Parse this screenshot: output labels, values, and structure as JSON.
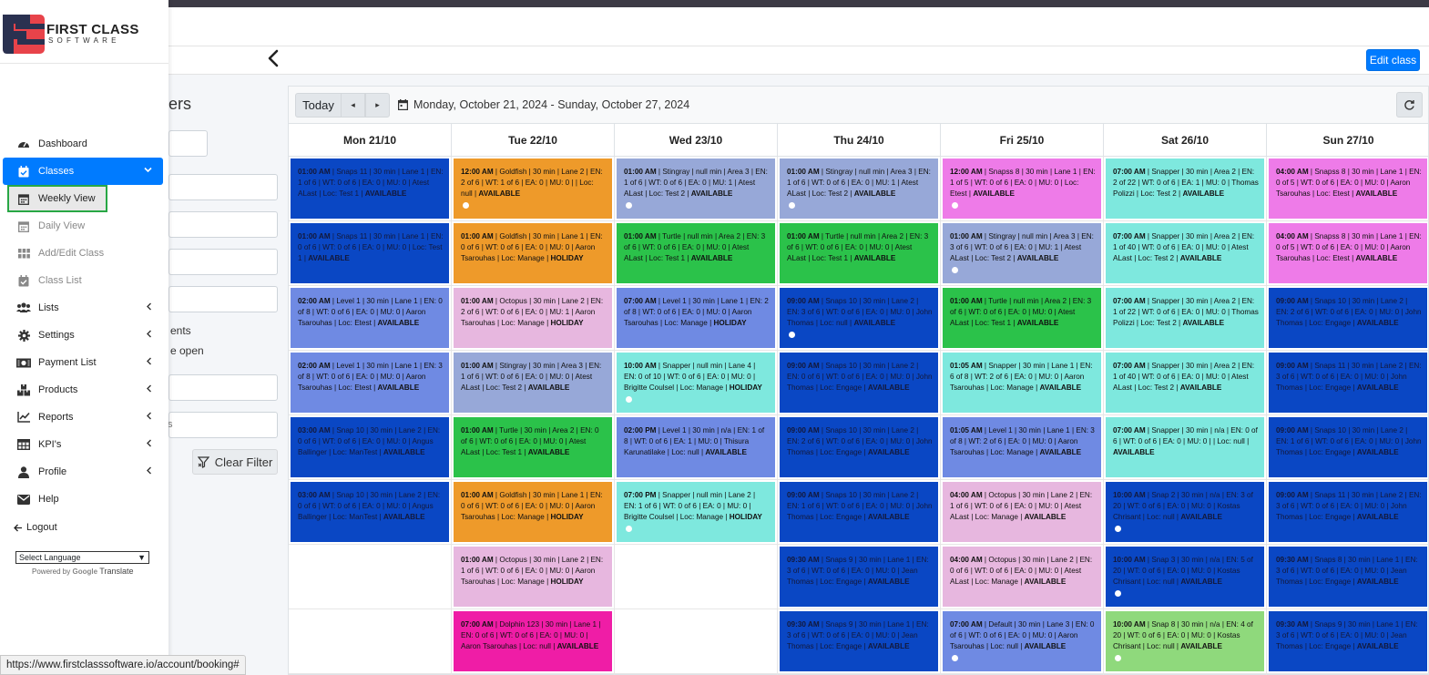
{
  "brand": {
    "line1": "FIRST CLASS",
    "line2": "SOFTWARE",
    "colors": {
      "red": "#e8434a",
      "navy": "#2a3150"
    }
  },
  "header": {
    "edit_class_label": "Edit class"
  },
  "filters": {
    "title_fragment": "ers",
    "check1_fragment": "ents",
    "check2_fragment": "e open",
    "ghost_fragment": "s",
    "clear_label": "Clear Filter"
  },
  "calendar": {
    "today_label": "Today",
    "prev_label": "◂",
    "next_label": "▸",
    "date_range": "Monday, October 21, 2024 - Sunday, October 27, 2024",
    "days": [
      "Mon 21/10",
      "Tue 22/10",
      "Wed 23/10",
      "Thu 24/10",
      "Fri 25/10",
      "Sat 26/10",
      "Sun 27/10"
    ],
    "columns": [
      [
        {
          "time": "01:00 AM",
          "text": " | Snaps 11 | 30 min | Lane 1 | EN: 1 of 6 | WT: 0 of 6 | EA: 0 | MU: 0 | Atest ALast | Loc: Test 1 | ",
          "status": "AVAILABLE",
          "color": "#0a47c4",
          "dark": true,
          "dot": false
        },
        {
          "time": "01:00 AM",
          "text": " | Snaps 11 | 30 min | Lane 1 | EN: 0 of 6 | WT: 0 of 6 | EA: 0 | MU: 0 | Loc: Test 1 | ",
          "status": "AVAILABLE",
          "color": "#0a47c4",
          "dark": true,
          "dot": false
        },
        {
          "time": "02:00 AM",
          "text": " | Level 1 | 30 min | Lane 1 | EN: 0 of 8 | WT: 0 of 6 | EA: 0 | MU: 0 | Aaron Tsarouhas | Loc: Etest | ",
          "status": "AVAILABLE",
          "color": "#6f8ae3",
          "dark": false,
          "dot": false
        },
        {
          "time": "02:00 AM",
          "text": " | Level 1 | 30 min | Lane 1 | EN: 3 of 8 | WT: 0 of 6 | EA: 0 | MU: 0 | Aaron Tsarouhas | Loc: Etest | ",
          "status": "AVAILABLE",
          "color": "#6f8ae3",
          "dark": false,
          "dot": false
        },
        {
          "time": "03:00 AM",
          "text": " | Snap 10 | 30 min | Lane 2 | EN: 0 of 6 | WT: 0 of 6 | EA: 0 | MU: 0 | Angus Ballinger | Loc: ManTest | ",
          "status": "AVAILABLE",
          "color": "#0a47c4",
          "dark": true,
          "dot": false
        },
        {
          "time": "03:00 AM",
          "text": " | Snap 10 | 30 min | Lane 2 | EN: 0 of 6 | WT: 0 of 6 | EA: 0 | MU: 0 | Angus Ballinger | Loc: ManTest | ",
          "status": "AVAILABLE",
          "color": "#0a47c4",
          "dark": true,
          "dot": false
        },
        null,
        null
      ],
      [
        {
          "time": "12:00 AM",
          "text": " | Goldfish | 30 min | Lane 2 | EN: 2 of 6 | WT: 1 of 6 | EA: 0 | MU: 0 | | Loc: null | ",
          "status": "AVAILABLE",
          "color": "#ee9a2a",
          "dark": false,
          "dot": true
        },
        {
          "time": "01:00 AM",
          "text": " | Goldfish | 30 min | Lane 1 | EN: 0 of 6 | WT: 0 of 6 | EA: 0 | MU: 0 | Aaron Tsarouhas | Loc: Manage | ",
          "status": "HOLIDAY",
          "color": "#ee9a2a",
          "dark": false,
          "dot": false
        },
        {
          "time": "01:00 AM",
          "text": " | Octopus | 30 min | Lane 2 | EN: 2 of 6 | WT: 0 of 6 | EA: 0 | MU: 1 | Aaron Tsarouhas | Loc: Manage | ",
          "status": "HOLIDAY",
          "color": "#e7b7df",
          "dark": false,
          "dot": false
        },
        {
          "time": "01:00 AM",
          "text": " | Stingray | 30 min | Area 3 | EN: 1 of 6 | WT: 0 of 6 | EA: 0 | MU: 0 | Atest ALast | Loc: Test 2 | ",
          "status": "AVAILABLE",
          "color": "#97a8d8",
          "dark": false,
          "dot": false
        },
        {
          "time": "01:00 AM",
          "text": " | Turtle | 30 min | Area 2 | EN: 0 of 6 | WT: 0 of 6 | EA: 0 | MU: 0 | Atest ALast | Loc: Test 1 | ",
          "status": "AVAILABLE",
          "color": "#2bc24a",
          "dark": false,
          "dot": false
        },
        {
          "time": "01:00 AM",
          "text": " | Goldfish | 30 min | Lane 1 | EN: 0 of 6 | WT: 0 of 6 | EA: 0 | MU: 0 | Aaron Tsarouhas | Loc: Manage | ",
          "status": "HOLIDAY",
          "color": "#ee9a2a",
          "dark": false,
          "dot": false
        },
        {
          "time": "01:00 AM",
          "text": " | Octopus | 30 min | Lane 2 | EN: 1 of 6 | WT: 0 of 6 | EA: 0 | MU: 0 | Aaron Tsarouhas | Loc: Manage | ",
          "status": "HOLIDAY",
          "color": "#e7b7df",
          "dark": false,
          "dot": false
        },
        {
          "time": "07:00 AM",
          "text": " | Dolphin 123 | 30 min | Lane 1 | EN: 0 of 6 | WT: 0 of 6 | EA: 0 | MU: 0 | Aaron Tsarouhas | Loc: null | ",
          "status": "AVAILABLE",
          "color": "#ef1da6",
          "dark": false,
          "dot": false
        }
      ],
      [
        {
          "time": "01:00 AM",
          "text": " | Stingray | null min | Area 3 | EN: 1 of 6 | WT: 0 of 6 | EA: 0 | MU: 1 | Atest ALast | Loc: Test 2 | ",
          "status": "AVAILABLE",
          "color": "#97a8d8",
          "dark": false,
          "dot": true
        },
        {
          "time": "01:00 AM",
          "text": " | Turtle | null min | Area 2 | EN: 3 of 6 | WT: 0 of 6 | EA: 0 | MU: 0 | Atest ALast | Loc: Test 1 | ",
          "status": "AVAILABLE",
          "color": "#2bc24a",
          "dark": false,
          "dot": false
        },
        {
          "time": "07:00 AM",
          "text": " | Level 1 | 30 min | Lane 1 | EN: 2 of 8 | WT: 0 of 6 | EA: 0 | MU: 0 | Aaron Tsarouhas | Loc: Manage | ",
          "status": "HOLIDAY",
          "color": "#6f8ae3",
          "dark": false,
          "dot": false
        },
        {
          "time": "10:00 AM",
          "text": " | Snapper | null min | Lane 4 | EN: 0 of 10 | WT: 0 of 6 | EA: 0 | MU: 0 | Brigitte Coulsel | Loc: Manage | ",
          "status": "HOLIDAY",
          "color": "#7ee8de",
          "dark": false,
          "dot": true
        },
        {
          "time": "02:00 PM",
          "text": " | Level 1 | 30 min | n/a | EN: 1 of 8 | WT: 0 of 6 | EA: 1 | MU: 0 | Thisura Karunatilake | Loc: null | ",
          "status": "AVAILABLE",
          "color": "#6f8ae3",
          "dark": false,
          "dot": false
        },
        {
          "time": "07:00 PM",
          "text": " | Snapper | null min | Lane 2 | EN: 1 of 6 | WT: 0 of 6 | EA: 0 | MU: 0 | Brigitte Coulsel | Loc: Manage | ",
          "status": "HOLIDAY",
          "color": "#7ee8de",
          "dark": false,
          "dot": true
        },
        null,
        null
      ],
      [
        {
          "time": "01:00 AM",
          "text": " | Stingray | null min | Area 3 | EN: 1 of 6 | WT: 0 of 6 | EA: 0 | MU: 1 | Atest ALast | Loc: Test 2 | ",
          "status": "AVAILABLE",
          "color": "#97a8d8",
          "dark": false,
          "dot": true
        },
        {
          "time": "01:00 AM",
          "text": " | Turtle | null min | Area 2 | EN: 3 of 6 | WT: 0 of 6 | EA: 0 | MU: 0 | Atest ALast | Loc: Test 1 | ",
          "status": "AVAILABLE",
          "color": "#2bc24a",
          "dark": false,
          "dot": false
        },
        {
          "time": "09:00 AM",
          "text": " | Snaps 10 | 30 min | Lane 2 | EN: 3 of 6 | WT: 0 of 6 | EA: 0 | MU: 0 | John Thomas | Loc: null | ",
          "status": "AVAILABLE",
          "color": "#0a47c4",
          "dark": true,
          "dot": true
        },
        {
          "time": "09:00 AM",
          "text": " | Snaps 10 | 30 min | Lane 2 | EN: 0 of 6 | WT: 0 of 6 | EA: 0 | MU: 0 | John Thomas | Loc: Engage | ",
          "status": "AVAILABLE",
          "color": "#0a47c4",
          "dark": true,
          "dot": false
        },
        {
          "time": "09:00 AM",
          "text": " | Snaps 10 | 30 min | Lane 2 | EN: 2 of 6 | WT: 0 of 6 | EA: 0 | MU: 0 | John Thomas | Loc: Engage | ",
          "status": "AVAILABLE",
          "color": "#0a47c4",
          "dark": true,
          "dot": false
        },
        {
          "time": "09:00 AM",
          "text": " | Snaps 10 | 30 min | Lane 2 | EN: 1 of 6 | WT: 0 of 6 | EA: 0 | MU: 0 | John Thomas | Loc: Engage | ",
          "status": "AVAILABLE",
          "color": "#0a47c4",
          "dark": true,
          "dot": false
        },
        {
          "time": "09:30 AM",
          "text": " | Snaps 9 | 30 min | Lane 1 | EN: 3 of 6 | WT: 0 of 6 | EA: 0 | MU: 0 | Jean Thomas | Loc: Engage | ",
          "status": "AVAILABLE",
          "color": "#0a47c4",
          "dark": true,
          "dot": false
        },
        {
          "time": "09:30 AM",
          "text": " | Snaps 9 | 30 min | Lane 1 | EN: 3 of 6 | WT: 0 of 6 | EA: 0 | MU: 0 | Jean Thomas | Loc: Engage | ",
          "status": "AVAILABLE",
          "color": "#0a47c4",
          "dark": true,
          "dot": false
        }
      ],
      [
        {
          "time": "12:00 AM",
          "text": " | Snapss 8 | 30 min | Lane 1 | EN: 1 of 5 | WT: 0 of 6 | EA: 0 | MU: 0 | Loc: Etest | ",
          "status": "AVAILABLE",
          "color": "#ee7be8",
          "dark": false,
          "dot": true
        },
        {
          "time": "01:00 AM",
          "text": " | Stingray | null min | Area 3 | EN: 3 of 6 | WT: 0 of 6 | EA: 0 | MU: 1 | Atest ALast | Loc: Test 2 | ",
          "status": "AVAILABLE",
          "color": "#97a8d8",
          "dark": false,
          "dot": true
        },
        {
          "time": "01:00 AM",
          "text": " | Turtle | null min | Area 2 | EN: 3 of 6 | WT: 0 of 6 | EA: 0 | MU: 0 | Atest ALast | Loc: Test 1 | ",
          "status": "AVAILABLE",
          "color": "#2bc24a",
          "dark": false,
          "dot": false
        },
        {
          "time": "01:05 AM",
          "text": " | Snapper | 30 min | Lane 1 | EN: 6 of 8 | WT: 2 of 6 | EA: 0 | MU: 0 | Aaron Tsarouhas | Loc: Manage | ",
          "status": "AVAILABLE",
          "color": "#7ee8de",
          "dark": false,
          "dot": false
        },
        {
          "time": "01:05 AM",
          "text": " | Level 1 | 30 min | Lane 1 | EN: 3 of 8 | WT: 2 of 6 | EA: 0 | MU: 0 | Aaron Tsarouhas | Loc: Manage | ",
          "status": "AVAILABLE",
          "color": "#6f8ae3",
          "dark": false,
          "dot": false
        },
        {
          "time": "04:00 AM",
          "text": " | Octopus | 30 min | Lane 2 | EN: 1 of 6 | WT: 0 of 6 | EA: 0 | MU: 0 | Atest ALast | Loc: Manage | ",
          "status": "AVAILABLE",
          "color": "#e7b7df",
          "dark": false,
          "dot": false
        },
        {
          "time": "04:00 AM",
          "text": " | Octopus | 30 min | Lane 2 | EN: 0 of 6 | WT: 0 of 6 | EA: 0 | MU: 0 | Atest ALast | Loc: Manage | ",
          "status": "AVAILABLE",
          "color": "#e7b7df",
          "dark": false,
          "dot": false
        },
        {
          "time": "07:00 AM",
          "text": " | Default | 30 min | Lane 3 | EN: 0 of 6 | WT: 0 of 6 | EA: 0 | MU: 0 | Aaron Tsarouhas | Loc: null | ",
          "status": "AVAILABLE",
          "color": "#6f8ae3",
          "dark": false,
          "dot": true
        }
      ],
      [
        {
          "time": "07:00 AM",
          "text": " | Snapper | 30 min | Area 2 | EN: 2 of 22 | WT: 0 of 6 | EA: 1 | MU: 0 | Thomas Polizzi | Loc: Test 2 | ",
          "status": "AVAILABLE",
          "color": "#7ee8de",
          "dark": false,
          "dot": false
        },
        {
          "time": "07:00 AM",
          "text": " | Snapper | 30 min | Area 2 | EN: 1 of 40 | WT: 0 of 6 | EA: 0 | MU: 0 | Atest ALast | Loc: Test 2 | ",
          "status": "AVAILABLE",
          "color": "#7ee8de",
          "dark": false,
          "dot": false
        },
        {
          "time": "07:00 AM",
          "text": " | Snapper | 30 min | Area 2 | EN: 1 of 22 | WT: 0 of 6 | EA: 0 | MU: 0 | Thomas Polizzi | Loc: Test 2 | ",
          "status": "AVAILABLE",
          "color": "#7ee8de",
          "dark": false,
          "dot": false
        },
        {
          "time": "07:00 AM",
          "text": " | Snapper | 30 min | Area 2 | EN: 1 of 40 | WT: 0 of 6 | EA: 0 | MU: 0 | Atest ALast | Loc: Test 2 | ",
          "status": "AVAILABLE",
          "color": "#7ee8de",
          "dark": false,
          "dot": false
        },
        {
          "time": "07:00 AM",
          "text": " | Snapper | 30 min | n/a | EN: 0 of 6 | WT: 0 of 6 | EA: 0 | MU: 0 | | Loc: null | ",
          "status": "AVAILABLE",
          "color": "#7ee8de",
          "dark": false,
          "dot": false
        },
        {
          "time": "10:00 AM",
          "text": " | Snap 2 | 30 min | n/a | EN: 3 of 20 | WT: 0 of 6 | EA: 0 | MU: 0 | Kostas Chrisant | Loc: null | ",
          "status": "AVAILABLE",
          "color": "#0a47c4",
          "dark": true,
          "dot": true
        },
        {
          "time": "10:00 AM",
          "text": " | Snap 3 | 30 min | n/a | EN: 5 of 20 | WT: 0 of 6 | EA: 0 | MU: 0 | Kostas Chrisant | Loc: null | ",
          "status": "AVAILABLE",
          "color": "#0a47c4",
          "dark": true,
          "dot": true
        },
        {
          "time": "10:00 AM",
          "text": " | Snap 8 | 30 min | n/a | EN: 4 of 20 | WT: 0 of 6 | EA: 0 | MU: 0 | Kostas Chrisant | Loc: null | ",
          "status": "AVAILABLE",
          "color": "#8fd97c",
          "dark": false,
          "dot": true
        }
      ],
      [
        {
          "time": "04:00 AM",
          "text": " | Snapss 8 | 30 min | Lane 1 | EN: 0 of 5 | WT: 0 of 6 | EA: 0 | MU: 0 | Aaron Tsarouhas | Loc: Etest | ",
          "status": "AVAILABLE",
          "color": "#ee7be8",
          "dark": false,
          "dot": false
        },
        {
          "time": "04:00 AM",
          "text": " | Snapss 8 | 30 min | Lane 1 | EN: 0 of 5 | WT: 0 of 6 | EA: 0 | MU: 0 | Aaron Tsarouhas | Loc: Etest | ",
          "status": "AVAILABLE",
          "color": "#ee7be8",
          "dark": false,
          "dot": false
        },
        {
          "time": "09:00 AM",
          "text": " | Snaps 10 | 30 min | Lane 2 | EN: 2 of 6 | WT: 0 of 6 | EA: 0 | MU: 0 | John Thomas | Loc: Engage | ",
          "status": "AVAILABLE",
          "color": "#0a47c4",
          "dark": true,
          "dot": false
        },
        {
          "time": "09:00 AM",
          "text": " | Snaps 11 | 30 min | Lane 2 | EN: 3 of 6 | WT: 0 of 6 | EA: 0 | MU: 0 | John Thomas | Loc: Engage | ",
          "status": "AVAILABLE",
          "color": "#0a47c4",
          "dark": true,
          "dot": false
        },
        {
          "time": "09:00 AM",
          "text": " | Snaps 10 | 30 min | Lane 2 | EN: 1 of 6 | WT: 0 of 6 | EA: 0 | MU: 0 | John Thomas | Loc: Engage | ",
          "status": "AVAILABLE",
          "color": "#0a47c4",
          "dark": true,
          "dot": false
        },
        {
          "time": "09:00 AM",
          "text": " | Snaps 11 | 30 min | Lane 2 | EN: 3 of 6 | WT: 0 of 6 | EA: 0 | MU: 0 | John Thomas | Loc: Engage | ",
          "status": "AVAILABLE",
          "color": "#0a47c4",
          "dark": true,
          "dot": false
        },
        {
          "time": "09:30 AM",
          "text": " | Snaps 8 | 30 min | Lane 1 | EN: 3 of 6 | WT: 0 of 6 | EA: 0 | MU: 0 | Jean Thomas | Loc: Engage | ",
          "status": "AVAILABLE",
          "color": "#0a47c4",
          "dark": true,
          "dot": false
        },
        {
          "time": "09:30 AM",
          "text": " | Snaps 9 | 30 min | Lane 1 | EN: 3 of 6 | WT: 0 of 6 | EA: 0 | MU: 0 | Jean Thomas | Loc: Engage | ",
          "status": "AVAILABLE",
          "color": "#0a47c4",
          "dark": true,
          "dot": false
        }
      ]
    ],
    "bottom_row_colors": [
      "",
      "#ee9a2a",
      "",
      "#7ee8de",
      "#0a47c4",
      "#0a47c4",
      "#0a47c4"
    ]
  },
  "sidebar": {
    "items": [
      {
        "label": "Dashboard",
        "icon": "dashboard-icon",
        "chev": false,
        "state": ""
      },
      {
        "label": "Classes",
        "icon": "calendar-check-icon",
        "chev": "down",
        "state": "active"
      },
      {
        "label": "Weekly View",
        "icon": "calendar-icon",
        "chev": false,
        "state": "sub current"
      },
      {
        "label": "Daily View",
        "icon": "calendar-icon",
        "chev": false,
        "state": "sub"
      },
      {
        "label": "Add/Edit Class",
        "icon": "grid-icon",
        "chev": false,
        "state": "sub"
      },
      {
        "label": "Class List",
        "icon": "calendar-check-icon",
        "chev": false,
        "state": "sub"
      },
      {
        "label": "Lists",
        "icon": "users-icon",
        "chev": "left",
        "state": ""
      },
      {
        "label": "Settings",
        "icon": "gear-icon",
        "chev": "left",
        "state": ""
      },
      {
        "label": "Payment List",
        "icon": "money-icon",
        "chev": "left",
        "state": ""
      },
      {
        "label": "Products",
        "icon": "products-icon",
        "chev": "left",
        "state": ""
      },
      {
        "label": "Reports",
        "icon": "chart-icon",
        "chev": "left",
        "state": ""
      },
      {
        "label": "KPI's",
        "icon": "table-icon",
        "chev": "left",
        "state": ""
      },
      {
        "label": "Profile",
        "icon": "user-icon",
        "chev": "left",
        "state": ""
      },
      {
        "label": "Help",
        "icon": "mail-icon",
        "chev": false,
        "state": ""
      }
    ],
    "logout_label": "Logout",
    "language_select": "Select Language",
    "powered_by": "Powered by",
    "google": "Google",
    "translate": "Translate"
  },
  "status_url": "https://www.firstclasssoftware.io/account/booking#"
}
